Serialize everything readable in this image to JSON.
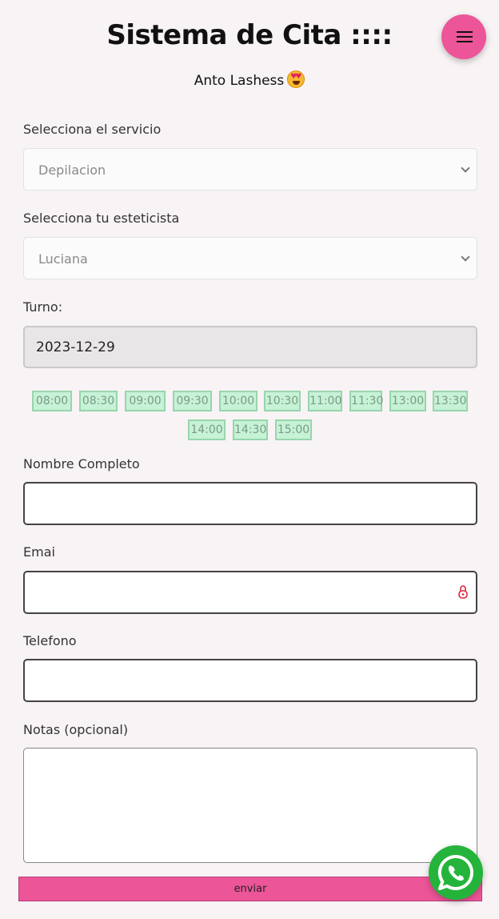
{
  "header": {
    "title": "Sistema de Cita ::::",
    "subtitle": "Anto Lashess",
    "menu_icon": "hamburger-menu-icon",
    "accent_color": "#ec5598"
  },
  "form": {
    "service": {
      "label": "Selecciona el servicio",
      "value": "Depilacion"
    },
    "esthetician": {
      "label": "Selecciona tu esteticista",
      "value": "Luciana"
    },
    "turno": {
      "label": "Turno:",
      "value": "2023-12-29"
    },
    "slots": [
      "08:00",
      "08:30",
      "09:00",
      "09:30",
      "10:00",
      "10:30",
      "11:00",
      "11:30",
      "13:00",
      "13:30",
      "14:00",
      "14:30",
      "15:00"
    ],
    "name": {
      "label": "Nombre Completo",
      "value": ""
    },
    "email": {
      "label": "Emai",
      "value": ""
    },
    "phone": {
      "label": "Telefono",
      "value": ""
    },
    "notes": {
      "label": "Notas (opcional)",
      "value": ""
    },
    "submit_label": "enviar"
  },
  "whatsapp": {
    "icon": "whatsapp-icon",
    "color": "#25b43b"
  }
}
